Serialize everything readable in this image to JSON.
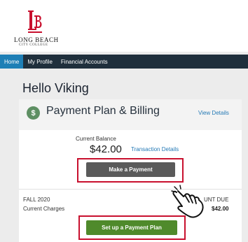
{
  "brand": {
    "logo_letters": "LB",
    "name_line1": "LONG BEACH",
    "name_line2": "CITY COLLEGE",
    "color": "#c8102e"
  },
  "nav": {
    "items": [
      {
        "label": "Home",
        "active": true
      },
      {
        "label": "My Profile",
        "active": false
      },
      {
        "label": "Financial Accounts",
        "active": false
      }
    ]
  },
  "greeting": "Hello Viking",
  "card": {
    "icon": "dollar-icon",
    "title": "Payment Plan & Billing",
    "view_details": "View Details",
    "current_balance_label": "Current Balance",
    "current_balance": "$42.00",
    "transaction_details": "Transaction Details",
    "make_payment": "Make a Payment",
    "term": "FALL 2020",
    "charges_label": "Current Charges",
    "amount_due_label": "UNT DUE",
    "amount_due": "$42.00",
    "payment_plan": "Set up a Payment Plan"
  },
  "colors": {
    "nav_bg": "#1f2f3c",
    "nav_active": "#1e7fb6",
    "highlight": "#c8102e",
    "link": "#2479b5",
    "plan_button": "#4f8a2b"
  }
}
